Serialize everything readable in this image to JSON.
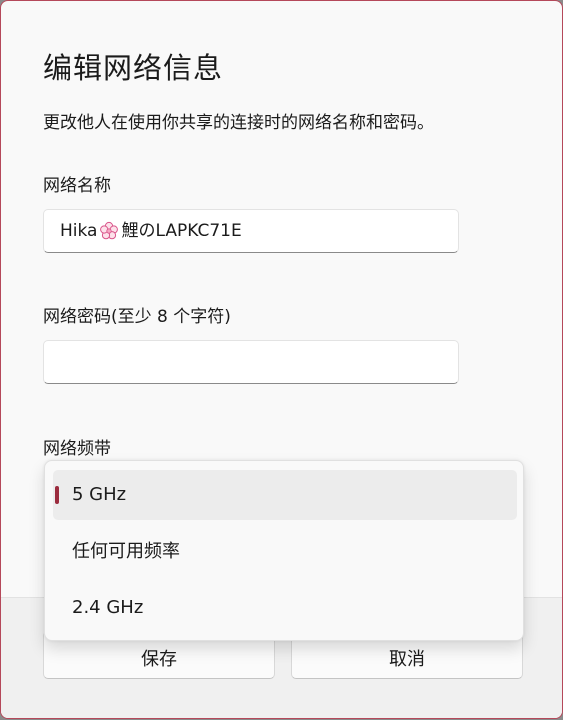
{
  "dialog": {
    "title": "编辑网络信息",
    "subtitle": "更改他人在使用你共享的连接时的网络名称和密码。"
  },
  "network_name": {
    "label": "网络名称",
    "value_prefix": "Hika",
    "value_suffix": "鯉のLAPKC71E"
  },
  "password": {
    "label": "网络密码(至少 8 个字符)",
    "value": ""
  },
  "band": {
    "label": "网络频带",
    "options": [
      "5 GHz",
      "任何可用频率",
      "2.4 GHz"
    ],
    "selected": "5 GHz"
  },
  "buttons": {
    "save": "保存",
    "cancel": "取消"
  },
  "colors": {
    "accent": "#9b2c3e",
    "border_accent": "#b5485a"
  }
}
